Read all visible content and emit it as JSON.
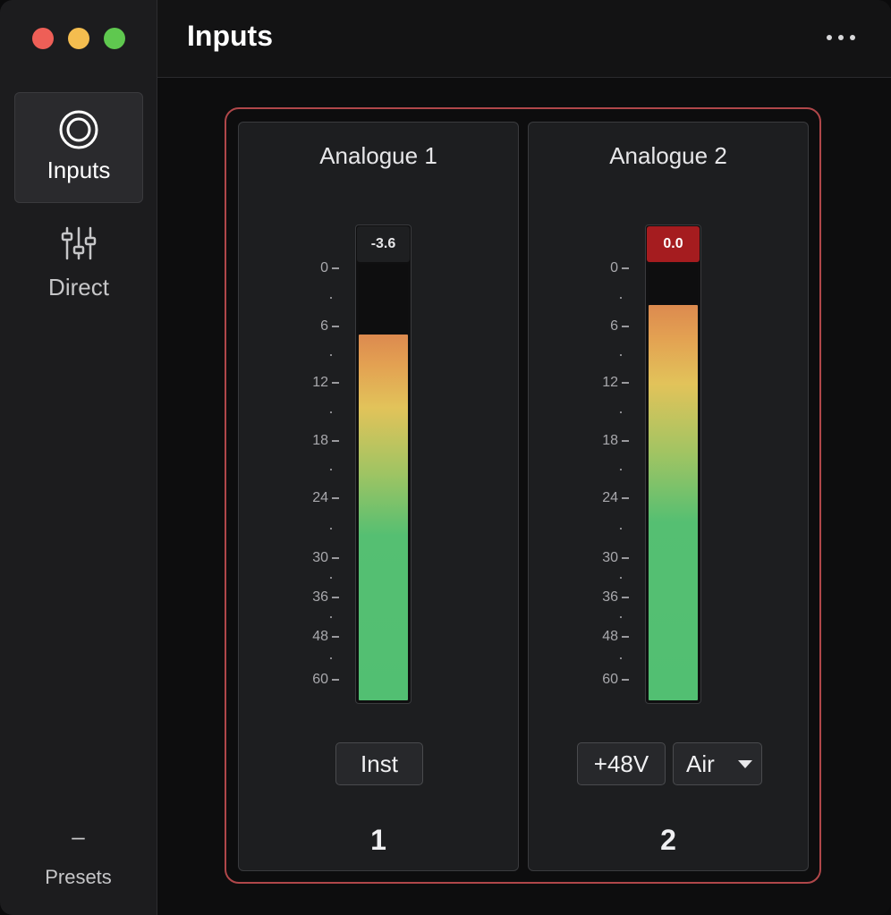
{
  "window": {
    "title": "Inputs"
  },
  "sidebar": {
    "items": [
      {
        "label": "Inputs",
        "icon": "inputs-ring-icon",
        "active": true
      },
      {
        "label": "Direct",
        "icon": "mixer-sliders-icon",
        "active": false
      }
    ],
    "presets": {
      "dash": "–",
      "label": "Presets"
    }
  },
  "colors": {
    "accent": "#b0474a",
    "clip": "#a51c1f",
    "meter_green": "#52bf72",
    "meter_yellow": "#e2c35a",
    "meter_orange": "#dc8a4f"
  },
  "meter_scale": [
    {
      "label": "0",
      "db": 0
    },
    {
      "label": "6",
      "db": 6
    },
    {
      "label": "12",
      "db": 12
    },
    {
      "label": "18",
      "db": 18
    },
    {
      "label": "24",
      "db": 24
    },
    {
      "label": "30",
      "db": 30
    },
    {
      "label": "36",
      "db": 36
    },
    {
      "label": "48",
      "db": 48
    },
    {
      "label": "60",
      "db": 60
    }
  ],
  "channels": [
    {
      "title": "Analogue 1",
      "peak": "-3.6",
      "level_db": -3.6,
      "clipping": false,
      "inst_label": "Inst",
      "number": "1"
    },
    {
      "title": "Analogue 2",
      "peak": "0.0",
      "level_db": 0.0,
      "clipping": true,
      "phantom_label": "+48V",
      "air_label": "Air",
      "number": "2"
    }
  ]
}
